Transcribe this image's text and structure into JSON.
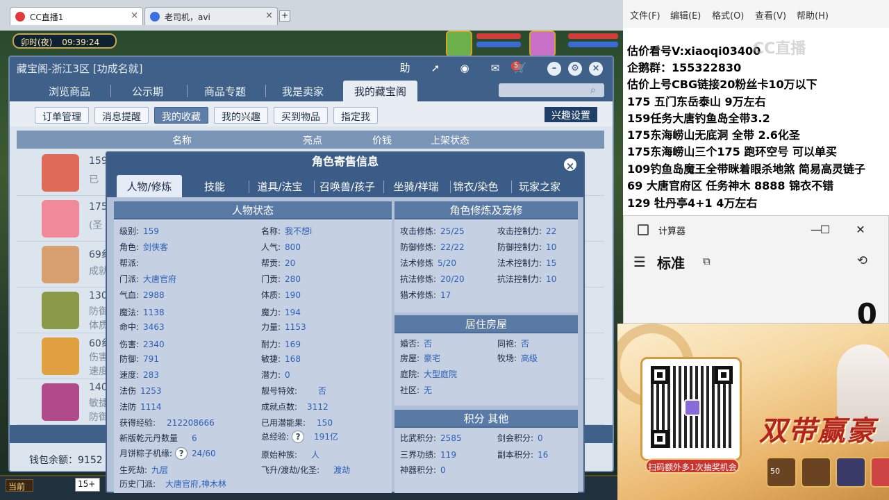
{
  "browser": {
    "tabs": [
      {
        "label": "CC直播1",
        "active": true
      },
      {
        "label": "老司机，avi",
        "active": false
      }
    ],
    "add_tab": "+"
  },
  "game": {
    "time_period": "卯时(夜)",
    "clock": "09:39:24",
    "current_label": "当前",
    "chat_input": "15+"
  },
  "cbg": {
    "title": "藏宝阁-浙江3区 [功成名就]",
    "header_buttons": {
      "help": "助",
      "message_badge": "5"
    },
    "nav": [
      "浏览商品",
      "公示期",
      "商品专题",
      "我是卖家",
      "我的藏宝阁"
    ],
    "nav_active": "我的藏宝阁",
    "subtabs": [
      "订单管理",
      "消息提醒",
      "我的收藏",
      "我的兴趣",
      "买到物品",
      "指定我"
    ],
    "subtab_active": "我的收藏",
    "interest_settings": "兴趣设置",
    "table_headers": [
      "名称",
      "亮点",
      "价钱",
      "上架状态"
    ],
    "rows": [
      {
        "line1": "159",
        "line2": "已"
      },
      {
        "line1": "175",
        "line2": "(圣"
      },
      {
        "line1": "69纟",
        "line2": "成就"
      },
      {
        "line1": "130",
        "line2": "防御",
        "line3": "体质"
      },
      {
        "line1": "60纟",
        "line2": "伤害",
        "line3": "速度"
      },
      {
        "line1": "140",
        "line2": "敏捷",
        "line3": "防御"
      }
    ],
    "wallet": "钱包余额：9152"
  },
  "role": {
    "title": "角色寄售信息",
    "tabs": [
      "人物/修炼",
      "技能",
      "道具/法宝",
      "召唤兽/孩子",
      "坐骑/祥瑞",
      "锦衣/染色",
      "玩家之家"
    ],
    "tab_active": "人物/修炼",
    "status": {
      "title": "人物状态",
      "left": [
        {
          "k": "级别:",
          "v": "159"
        },
        {
          "k": "角色:",
          "v": "剑侠客"
        },
        {
          "k": "帮派:",
          "v": ""
        },
        {
          "k": "门派:",
          "v": "大唐官府"
        },
        {
          "k": "气血:",
          "v": "2988"
        },
        {
          "k": "魔法:",
          "v": "1138"
        },
        {
          "k": "命中:",
          "v": "3463"
        },
        {
          "k": "伤害:",
          "v": "2340"
        },
        {
          "k": "防御:",
          "v": "791"
        },
        {
          "k": "速度:",
          "v": "283"
        },
        {
          "k": "法伤",
          "v": "1253"
        },
        {
          "k": "法防",
          "v": "1114"
        }
      ],
      "right": [
        {
          "k": "名称:",
          "v": "我不想i"
        },
        {
          "k": "人气:",
          "v": "800"
        },
        {
          "k": "帮贡:",
          "v": "20"
        },
        {
          "k": "门贡:",
          "v": "280"
        },
        {
          "k": "体质:",
          "v": "190"
        },
        {
          "k": "魔力:",
          "v": "194"
        },
        {
          "k": "力量:",
          "v": "1153"
        },
        {
          "k": "耐力:",
          "v": "169"
        },
        {
          "k": "敏捷:",
          "v": "168"
        },
        {
          "k": "潜力:",
          "v": "0"
        },
        {
          "k": "靓号特效:",
          "v": "否"
        },
        {
          "k": "成就点数:",
          "v": "3112"
        }
      ],
      "bottom": {
        "exp_k": "获得经验:",
        "exp_v": "212208666",
        "potion_k": "已用潜能果:",
        "potion_v": "150",
        "qianyuan_k": "新版乾元丹数量",
        "qianyuan_v": "6",
        "total_exp_k": "总经验:",
        "total_exp_v": "191亿",
        "mooncake_k": "月饼粽子机缘:",
        "mooncake_v": "24/60",
        "race_k": "原始种族:",
        "race_v": "人",
        "life_k": "生死劫:",
        "life_v": "九层",
        "ascend_k": "飞升/渡劫/化圣:",
        "ascend_v": "渡劫",
        "history_k": "历史门派:",
        "history_v": "大唐官府,神木林",
        "q": "?"
      }
    },
    "cultivation": {
      "title": "角色修炼及宠修",
      "rows": [
        {
          "k1": "攻击修炼:",
          "v1": "25/25",
          "k2": "攻击控制力:",
          "v2": "22"
        },
        {
          "k1": "防御修炼:",
          "v1": "22/22",
          "k2": "防御控制力:",
          "v2": "10"
        },
        {
          "k1": "法术修炼",
          "v1": "5/20",
          "k2": "法术控制力:",
          "v2": "15"
        },
        {
          "k1": "抗法修炼:",
          "v1": "20/20",
          "k2": "抗法控制力:",
          "v2": "10"
        },
        {
          "k1": "猎术修炼:",
          "v1": "17",
          "k2": "",
          "v2": ""
        }
      ]
    },
    "house": {
      "title": "居住房屋",
      "rows": [
        {
          "k1": "婚否:",
          "v1": "否",
          "k2": "同袍:",
          "v2": "否"
        },
        {
          "k1": "房屋:",
          "v1": "豪宅",
          "k2": "牧场:",
          "v2": "高级"
        },
        {
          "k1": "庭院:",
          "v1": "大型庭院",
          "k2": "",
          "v2": ""
        },
        {
          "k1": "社区:",
          "v1": "无",
          "k2": "",
          "v2": ""
        }
      ]
    },
    "points": {
      "title": "积分 其他",
      "rows": [
        {
          "k1": "比武积分:",
          "v1": "2585",
          "k2": "剑会积分:",
          "v2": "0"
        },
        {
          "k1": "三界功绩:",
          "v1": "119",
          "k2": "副本积分:",
          "v2": "16"
        },
        {
          "k1": "神器积分:",
          "v1": "0",
          "k2": "",
          "v2": ""
        }
      ]
    }
  },
  "notepad": {
    "menu": [
      "文件(F)",
      "编辑(E)",
      "格式(O)",
      "查看(V)",
      "帮助(H)"
    ],
    "lines": [
      "估价看号V:xiaoqi03400",
      "企鹅群：155322830",
      "估价上号CBG链接20粉丝卡10万以下",
      "175 五门东岳泰山  9万左右",
      "159任务大唐钓鱼岛全带3.2",
      "175东海崂山无底洞  全带   2.6化圣",
      "175东海崂山三个175 跑环空号 可以单买",
      "109钓鱼岛魔王全带眯着眼杀地煞 简易高灵链子",
      "69  大唐官府区 任务神木 8888 锦衣不错",
      "129 牡丹亭4+1 4万左右"
    ],
    "watermark": "CC直播"
  },
  "calculator": {
    "app_name": "计算器",
    "mode": "标准",
    "display": "0"
  },
  "ad": {
    "cta": "扫码额外多1次抽奖机会",
    "slogan": "双带赢豪",
    "thumb_value": "50"
  },
  "colors": {
    "cbg_header": "#3f6088",
    "role_value": "#2a5fb6",
    "ad_red": "#c9342e"
  }
}
